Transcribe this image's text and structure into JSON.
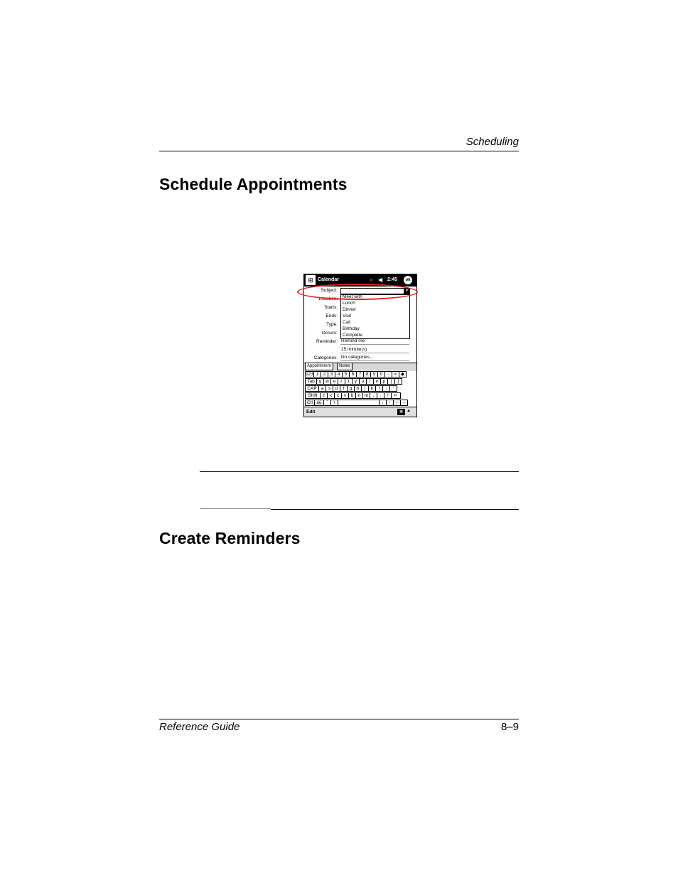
{
  "header": {
    "running_head": "Scheduling"
  },
  "sections": [
    {
      "title": "Schedule Appointments"
    },
    {
      "title": "Create Reminders"
    }
  ],
  "footer": {
    "left": "Reference Guide",
    "right": "8–9"
  },
  "device": {
    "app_title": "Calendar",
    "time": "2:45",
    "ok_label": "ok",
    "start_glyph": "⊞",
    "icons": {
      "connectivity": "speech-bubble-icon",
      "volume": "speaker-icon"
    },
    "labels": {
      "subject": "Subject:",
      "location": "Location:",
      "starts": "Starts:",
      "ends": "Ends:",
      "type": "Type:",
      "occurs": "Occurs:",
      "reminder": "Reminder:",
      "categories": "Categories:"
    },
    "subject_value": "",
    "dropdown_items": [
      "Meet with",
      "Lunch",
      "Dinner",
      "Visit",
      "Call",
      "Birthday",
      "Complete"
    ],
    "reminder_value": "Remind me",
    "reminder_minutes": "15   minute(s)",
    "categories_value": "No categories...",
    "tabs": [
      "Appointment",
      "Notes"
    ],
    "keyboard": {
      "row1": [
        "123",
        "1",
        "2",
        "3",
        "4",
        "5",
        "6",
        "7",
        "8",
        "9",
        "0",
        "-",
        "=",
        "◆"
      ],
      "row2": [
        "Tab",
        "q",
        "w",
        "e",
        "r",
        "t",
        "y",
        "u",
        "i",
        "o",
        "p",
        "[",
        "]"
      ],
      "row3": [
        "CAP",
        "a",
        "s",
        "d",
        "f",
        "g",
        "h",
        "j",
        "k",
        "l",
        ";",
        "'"
      ],
      "row4": [
        "Shift",
        "z",
        "x",
        "c",
        "v",
        "b",
        "n",
        "m",
        ",",
        ".",
        "/",
        "↵"
      ],
      "row5": [
        "Ctl",
        "áü",
        "`",
        "\\",
        " ",
        "↓",
        "↑",
        "←",
        "→"
      ]
    },
    "bottom_menu": "Edit",
    "highlight_color": "#e02020"
  }
}
